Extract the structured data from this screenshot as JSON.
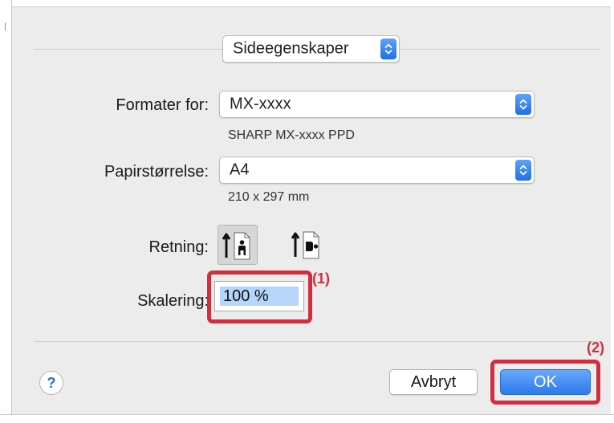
{
  "page_selector": {
    "value": "Sideegenskaper"
  },
  "format_for": {
    "label": "Formater for:",
    "value": "MX-xxxx",
    "description": "SHARP MX-xxxx PPD"
  },
  "paper_size": {
    "label": "Papirstørrelse:",
    "value": "A4",
    "description": "210 x 297 mm"
  },
  "orientation": {
    "label": "Retning:",
    "selected": "portrait",
    "options": [
      "portrait",
      "landscape"
    ]
  },
  "scaling": {
    "label": "Skalering:",
    "value": "100 %"
  },
  "annotations": {
    "callout_1": "(1)",
    "callout_2": "(2)",
    "color": "#d22d3f"
  },
  "footer": {
    "help_label": "?",
    "cancel_label": "Avbryt",
    "ok_label": "OK"
  },
  "colors": {
    "accent": "#2d79ec",
    "background": "#ececec",
    "selection": "#b5d5fb"
  }
}
